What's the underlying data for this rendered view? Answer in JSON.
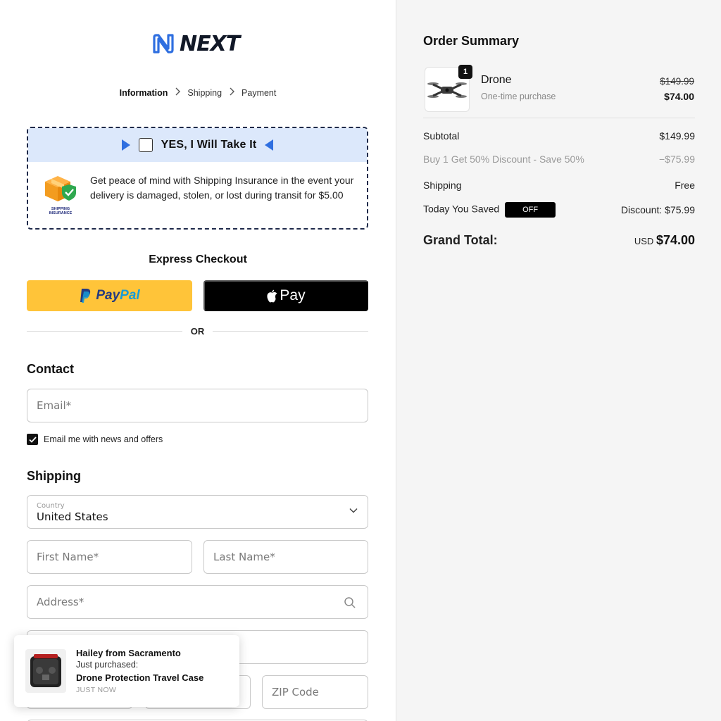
{
  "brand": {
    "logo_text": "NEXT"
  },
  "breadcrumb": {
    "step1": "Information",
    "step2": "Shipping",
    "step3": "Payment"
  },
  "insurance": {
    "title": "YES,  I Will Take It",
    "description": "Get peace of mind with Shipping Insurance in the event your delivery is damaged, stolen, or lost during transit for $5.00",
    "badge_text": "SHIPPING INSURANCE"
  },
  "express": {
    "title": "Express Checkout",
    "paypal_label": "PayPal",
    "apple_label": "Pay",
    "or_label": "OR"
  },
  "contact": {
    "heading": "Contact",
    "email_placeholder": "Email*",
    "newsletter_label": "Email me with news and offers",
    "newsletter_checked": true
  },
  "shipping": {
    "heading": "Shipping",
    "country_label": "Country",
    "country_value": "United States",
    "first_name_placeholder": "First Name*",
    "last_name_placeholder": "Last Name*",
    "address_placeholder": "Address*",
    "zip_placeholder": "ZIP Code"
  },
  "toast": {
    "name": "Hailey from Sacramento",
    "subtitle": "Just purchased:",
    "product": "Drone Protection Travel Case",
    "time": "JUST NOW"
  },
  "summary": {
    "title": "Order Summary",
    "item": {
      "name": "Drone",
      "subtitle": "One-time purchase",
      "quantity": "1",
      "old_price": "$149.99",
      "price": "$74.00"
    },
    "subtotal_label": "Subtotal",
    "subtotal_value": "$149.99",
    "discount_label": "Buy 1 Get 50% Discount - Save 50%",
    "discount_value": "−$75.99",
    "shipping_label": "Shipping",
    "shipping_value": "Free",
    "saved_label": "Today You Saved",
    "saved_badge": "OFF",
    "saved_value": "Discount: $75.99",
    "grand_label": "Grand Total:",
    "grand_currency": "USD",
    "grand_value": "$74.00"
  },
  "colors": {
    "accent_blue": "#2f6fe0",
    "paypal_yellow": "#ffc439",
    "insurance_bg": "#dce8fb",
    "panel_bg": "#f5f5f5"
  }
}
